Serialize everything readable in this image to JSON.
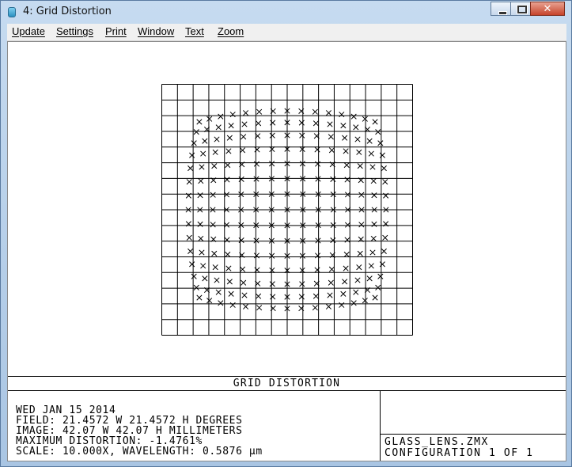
{
  "window": {
    "title": "4: Grid Distortion",
    "minimize_glyph": "",
    "maximize_glyph": "",
    "close_glyph": "✕"
  },
  "menu": [
    "Update",
    "Settings",
    "Print",
    "Window",
    "Text",
    "Zoom"
  ],
  "plot": {
    "grid_cells": 16,
    "marker": "x",
    "max_distortion_percent": -1.4761,
    "grid_color": "#000000"
  },
  "caption": {
    "title": "GRID DISTORTION",
    "lines": [
      "WED JAN 15 2014",
      "FIELD: 21.4572 W 21.4572 H DEGREES",
      "IMAGE: 42.07 W 42.07 H MILLIMETERS",
      "MAXIMUM DISTORTION: -1.4761%",
      "SCALE: 10.000X, WAVELENGTH: 0.5876 µm"
    ],
    "file": "GLASS_LENS.ZMX",
    "configuration": "CONFIGURATION 1 OF 1"
  }
}
